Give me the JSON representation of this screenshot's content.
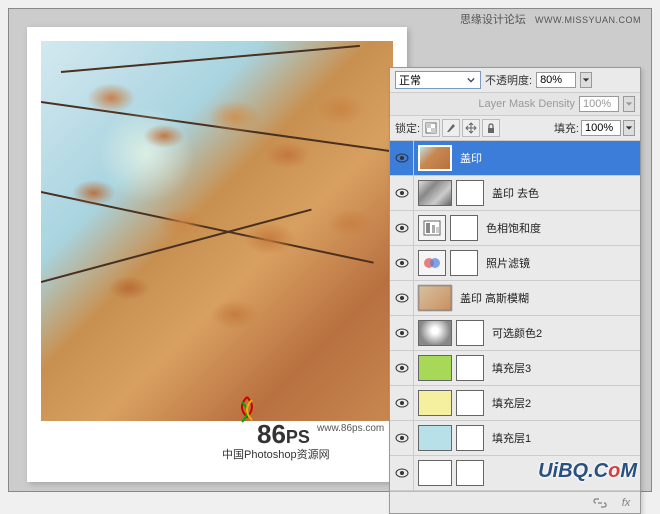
{
  "header": {
    "forum": "思缘设计论坛",
    "site": "WWW.MISSYUAN.COM"
  },
  "watermark": {
    "logo_main": "86",
    "logo_suffix": "PS",
    "url": "www.86ps.com",
    "subtitle": "中国Photoshop资源网"
  },
  "panel": {
    "blend_mode": "正常",
    "opacity_label": "不透明度:",
    "opacity_value": "80%",
    "mask_density_label": "Layer Mask Density",
    "mask_density_value": "100%",
    "lock_label": "锁定:",
    "fill_label": "填充:",
    "fill_value": "100%"
  },
  "layers": [
    {
      "name": "盖印",
      "selected": true,
      "thumb": "t-autumn",
      "mask": false
    },
    {
      "name": "盖印 去色",
      "thumb": "t-gray",
      "mask": true
    },
    {
      "name": "色相饱和度",
      "thumb": "adj-hue",
      "mask": true,
      "adj": true
    },
    {
      "name": "照片滤镜",
      "thumb": "adj-photo",
      "mask": true,
      "adj": true
    },
    {
      "name": "盖印 高斯模糊",
      "thumb": "t-blur",
      "mask": false
    },
    {
      "name": "可选颜色2",
      "thumb": "t-radial",
      "mask": true
    },
    {
      "name": "填充层3",
      "thumb": "t-green",
      "mask": true
    },
    {
      "name": "填充层2",
      "thumb": "t-yellow",
      "mask": true
    },
    {
      "name": "填充层1",
      "thumb": "t-blue",
      "mask": true
    },
    {
      "name": "",
      "thumb": "t-white",
      "mask": true
    }
  ],
  "footer_brand": {
    "pre": "UiBQ.C",
    "o": "o",
    "post": "M"
  }
}
